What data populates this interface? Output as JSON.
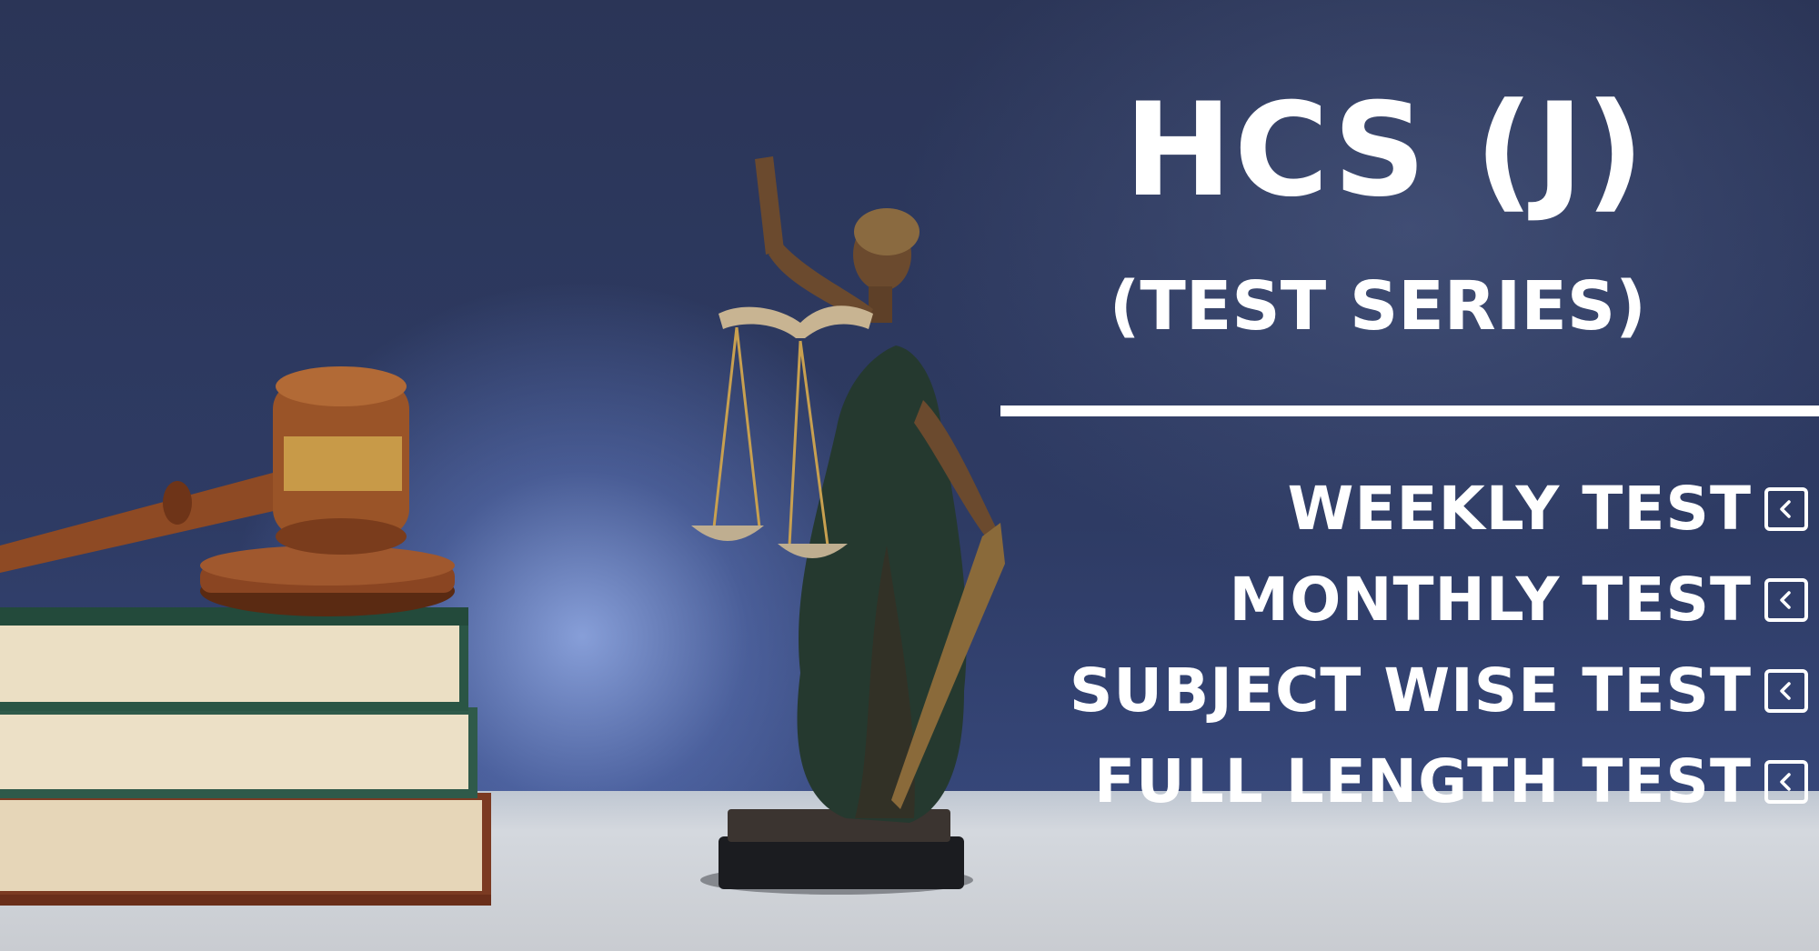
{
  "banner": {
    "title": "HCS (J)",
    "subtitle": "(TEST SERIES)",
    "tests": [
      {
        "label": "WEEKLY TEST",
        "icon": "chevron-left-square-icon"
      },
      {
        "label": "MONTHLY TEST",
        "icon": "chevron-left-square-icon"
      },
      {
        "label": "SUBJECT WISE TEST",
        "icon": "chevron-left-square-icon"
      },
      {
        "label": "FULL LENGTH TEST",
        "icon": "chevron-left-square-icon"
      }
    ]
  },
  "colors": {
    "background": "#2b3557",
    "text": "#ffffff",
    "table": "#c9ccd1",
    "bronze": "#7a5a3a",
    "wood": "#8a4a22"
  }
}
